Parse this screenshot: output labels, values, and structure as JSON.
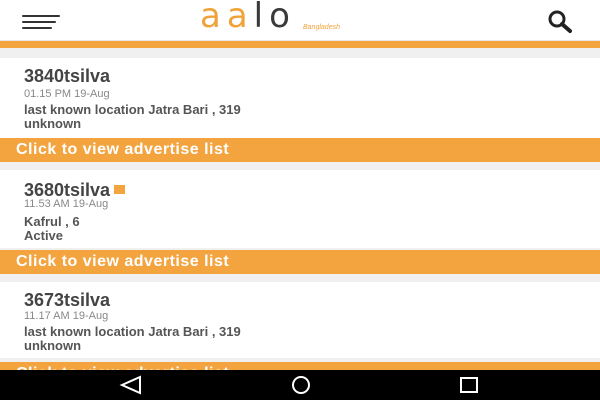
{
  "header": {
    "logo_text_a": "aa",
    "logo_text_b": "lo",
    "logo_subtitle": "Bangladesh"
  },
  "icons": {
    "menu": "hamburger-icon",
    "search": "search-icon",
    "back": "back-icon",
    "home": "home-icon",
    "recents": "recents-icon"
  },
  "colors": {
    "accent": "#f4a43f",
    "banner_text": "#ffffff",
    "navbar": "#000000"
  },
  "banner_label": "Click to view advertise list",
  "items": [
    {
      "name": "3840tsilva",
      "time": "01.15 PM 19-Aug",
      "location": "last known location Jatra Bari , 319",
      "status": "unknown",
      "badge": false
    },
    {
      "name": "3680tsilva",
      "time": "11.53 AM 19-Aug",
      "location": "Kafrul , 6",
      "status": "Active",
      "badge": true
    },
    {
      "name": "3673tsilva",
      "time": "11.17 AM 19-Aug",
      "location": "last known location Jatra Bari , 319",
      "status": "unknown",
      "badge": false
    }
  ]
}
